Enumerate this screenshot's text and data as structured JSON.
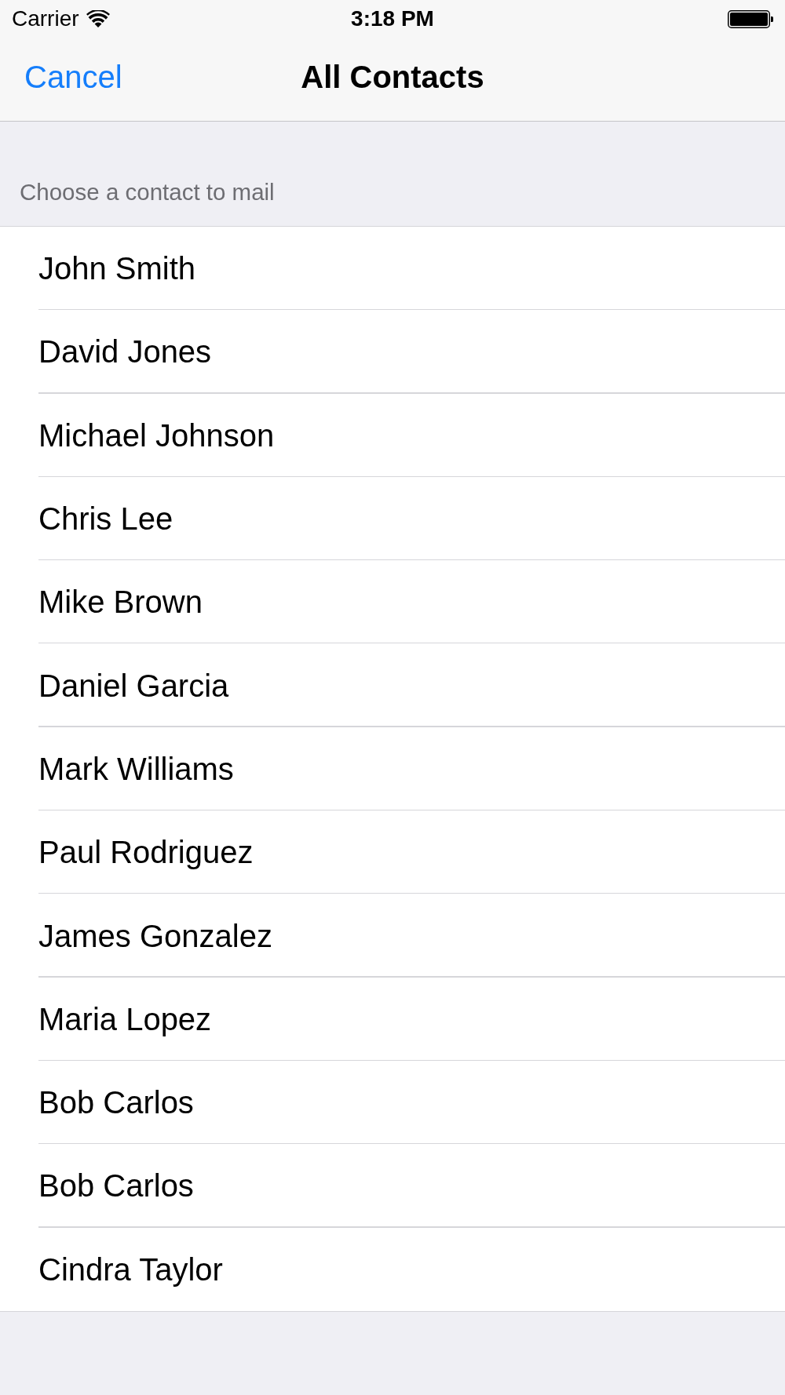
{
  "status_bar": {
    "carrier": "Carrier",
    "time": "3:18 PM"
  },
  "nav_bar": {
    "cancel": "Cancel",
    "title": "All Contacts"
  },
  "section": {
    "header": "Choose a contact to mail"
  },
  "contacts": [
    {
      "name": "John Smith"
    },
    {
      "name": "David Jones"
    },
    {
      "name": "Michael Johnson"
    },
    {
      "name": "Chris Lee"
    },
    {
      "name": "Mike Brown"
    },
    {
      "name": "Daniel Garcia"
    },
    {
      "name": "Mark Williams"
    },
    {
      "name": "Paul Rodriguez"
    },
    {
      "name": "James Gonzalez"
    },
    {
      "name": "Maria Lopez"
    },
    {
      "name": "Bob Carlos"
    },
    {
      "name": "Bob Carlos"
    },
    {
      "name": "Cindra Taylor"
    }
  ]
}
